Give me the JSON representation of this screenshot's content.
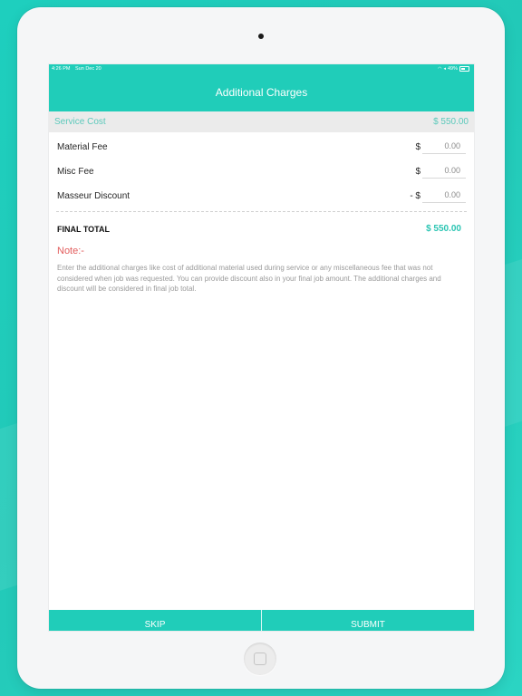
{
  "status_bar": {
    "time": "4:26 PM",
    "date": "Sun Dec 20",
    "battery": "49%"
  },
  "nav": {
    "title": "Additional Charges"
  },
  "service": {
    "label": "Service Cost",
    "value": "$ 550.00"
  },
  "fees": [
    {
      "label": "Material Fee",
      "currency": "$",
      "placeholder": "0.00"
    },
    {
      "label": "Misc Fee",
      "currency": "$",
      "placeholder": "0.00"
    },
    {
      "label": "Masseur Discount",
      "currency": "- $",
      "placeholder": "0.00"
    }
  ],
  "total": {
    "label": "FINAL TOTAL",
    "value": "$ 550.00"
  },
  "note": {
    "label": "Note:-",
    "text": "Enter the additional charges like cost of additional material used during service or any miscellaneous fee that was not considered when job was requested. You can provide discount also in your final job amount. The additional charges and discount will be considered in final job total."
  },
  "footer": {
    "skip_label": "SKIP",
    "submit_label": "SUBMIT"
  },
  "colors": {
    "accent": "#20cdb9",
    "note": "#e25c5c"
  },
  "icons": {
    "wifi": "wifi-icon",
    "signal": "signal-icon",
    "battery": "battery-icon"
  }
}
